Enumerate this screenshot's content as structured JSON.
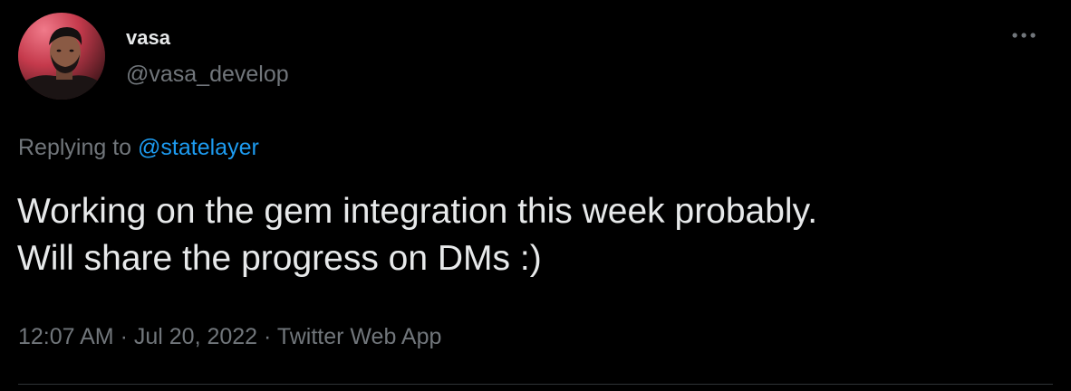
{
  "user": {
    "display_name": "vasa",
    "handle": "@vasa_develop"
  },
  "reply": {
    "prefix": "Replying to ",
    "mention": "@statelayer"
  },
  "tweet": {
    "lines": [
      "Working on the gem integration this week probably.",
      "Will share the progress on DMs :)"
    ]
  },
  "meta": {
    "time": "12:07 AM",
    "separator": " · ",
    "date": "Jul 20, 2022",
    "source": "Twitter Web App"
  },
  "icons": {
    "more": "more-horizontal-icon",
    "avatar": "user-avatar"
  },
  "colors": {
    "background": "#000000",
    "text_primary": "#e7e9ea",
    "text_secondary": "#71767b",
    "link": "#1d9bf0",
    "avatar_ring": "#e94b5c",
    "divider": "#2f3336"
  }
}
